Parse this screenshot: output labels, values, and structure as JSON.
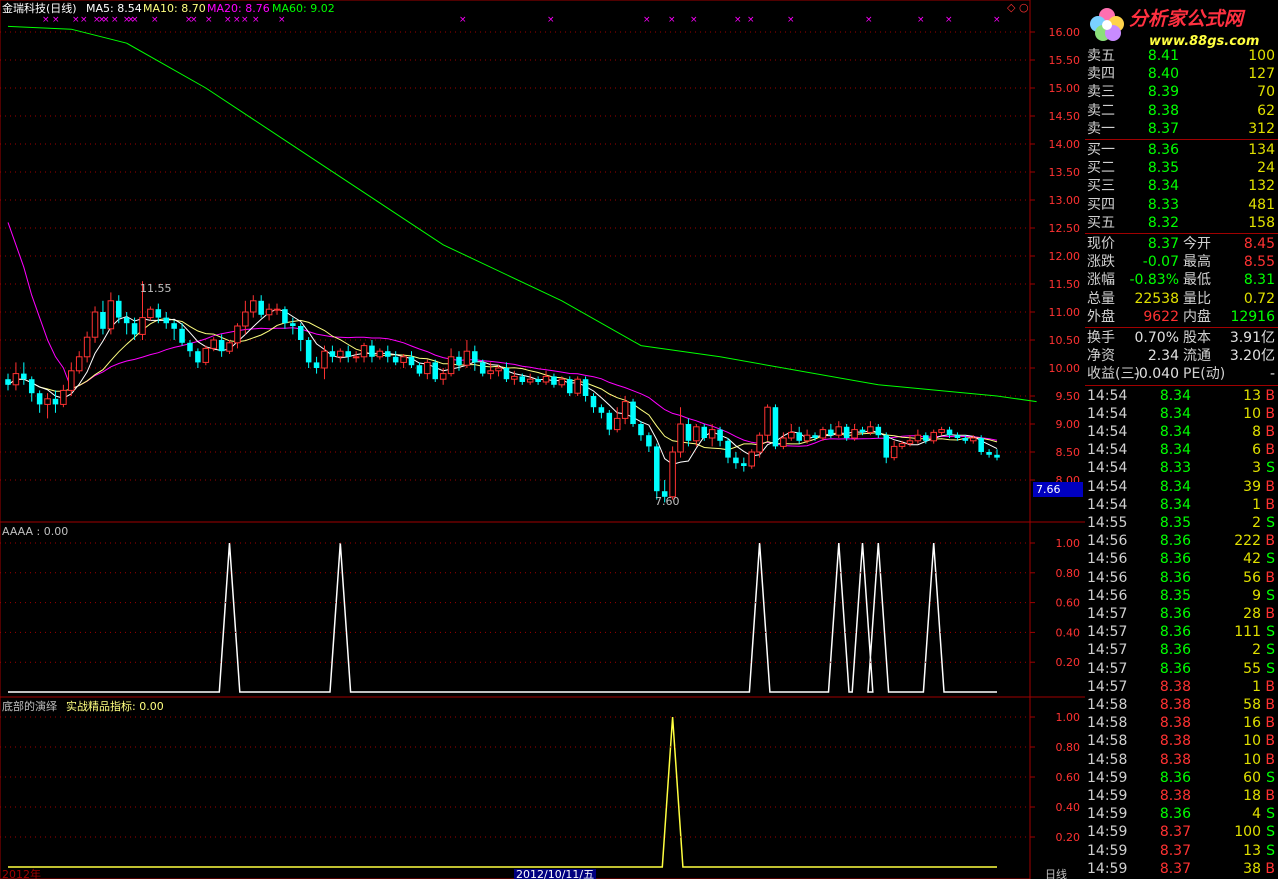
{
  "header": {
    "stock": "金瑞科技(日线)",
    "ma5": "MA5: 8.54",
    "ma10": "MA10: 8.70",
    "ma20": "MA20: 8.76",
    "ma60": "MA60: 9.02"
  },
  "price_axis": [
    "16.00",
    "15.50",
    "15.00",
    "14.50",
    "14.00",
    "13.50",
    "13.00",
    "12.50",
    "12.00",
    "11.50",
    "11.00",
    "10.50",
    "10.00",
    "9.50",
    "9.00",
    "8.50",
    "8.00"
  ],
  "current_price_tag": "7.66",
  "annotations": {
    "high": "11.55",
    "low": "7.60"
  },
  "panel2": {
    "title": "AAAA : 0.00",
    "axis": [
      "1.00",
      "0.80",
      "0.60",
      "0.40",
      "0.20"
    ]
  },
  "panel3": {
    "title": "底部的演绎",
    "indicator": "实战精品指标: 0.00",
    "axis": [
      "1.00",
      "0.80",
      "0.60",
      "0.40",
      "0.20"
    ]
  },
  "bottom_labels": {
    "left": "2012年",
    "date": "2012/10/11/五",
    "right": "日线"
  },
  "colors": {
    "up": "#ff3232",
    "down": "#00ffff",
    "ma5": "#ffffff",
    "ma10": "#ffff80",
    "ma20": "#ff00ff",
    "ma60": "#00ff00",
    "grid": "#a00000"
  },
  "logo": {
    "name": "分析家公式网",
    "url": "www.88gs.com"
  },
  "order_book": {
    "sell": [
      {
        "label": "卖五",
        "price": "8.41",
        "vol": "100"
      },
      {
        "label": "卖四",
        "price": "8.40",
        "vol": "127"
      },
      {
        "label": "卖三",
        "price": "8.39",
        "vol": "70"
      },
      {
        "label": "卖二",
        "price": "8.38",
        "vol": "62"
      },
      {
        "label": "卖一",
        "price": "8.37",
        "vol": "312"
      }
    ],
    "buy": [
      {
        "label": "买一",
        "price": "8.36",
        "vol": "134"
      },
      {
        "label": "买二",
        "price": "8.35",
        "vol": "24"
      },
      {
        "label": "买三",
        "price": "8.34",
        "vol": "132"
      },
      {
        "label": "买四",
        "price": "8.33",
        "vol": "481"
      },
      {
        "label": "买五",
        "price": "8.32",
        "vol": "158"
      }
    ]
  },
  "quote": [
    {
      "l1": "现价",
      "v1": "8.37",
      "c1": "dn",
      "l2": "今开",
      "v2": "8.45",
      "c2": "up"
    },
    {
      "l1": "涨跌",
      "v1": "-0.07",
      "c1": "dn",
      "l2": "最高",
      "v2": "8.55",
      "c2": "up"
    },
    {
      "l1": "涨幅",
      "v1": "-0.83%",
      "c1": "dn",
      "l2": "最低",
      "v2": "8.31",
      "c2": "dn"
    },
    {
      "l1": "总量",
      "v1": "22538",
      "c1": "yl",
      "l2": "量比",
      "v2": "0.72",
      "c2": "yl"
    },
    {
      "l1": "外盘",
      "v1": "9622",
      "c1": "up",
      "l2": "内盘",
      "v2": "12916",
      "c2": "dn"
    },
    {
      "l1": "换手",
      "v1": "0.70%",
      "c1": "wh",
      "l2": "股本",
      "v2": "3.91亿",
      "c2": "wh"
    },
    {
      "l1": "净资",
      "v1": "2.34",
      "c1": "wh",
      "l2": "流通",
      "v2": "3.20亿",
      "c2": "wh"
    },
    {
      "l1": "收益(三)",
      "v1": "-0.040",
      "c1": "wh",
      "l2": "PE(动)",
      "v2": "-",
      "c2": "wh"
    }
  ],
  "ticks": [
    {
      "t": "14:54",
      "p": "8.34",
      "v": "13",
      "f": "B"
    },
    {
      "t": "14:54",
      "p": "8.34",
      "v": "10",
      "f": "B"
    },
    {
      "t": "14:54",
      "p": "8.34",
      "v": "8",
      "f": "B"
    },
    {
      "t": "14:54",
      "p": "8.34",
      "v": "6",
      "f": "B"
    },
    {
      "t": "14:54",
      "p": "8.33",
      "v": "3",
      "f": "S"
    },
    {
      "t": "14:54",
      "p": "8.34",
      "v": "39",
      "f": "B"
    },
    {
      "t": "14:54",
      "p": "8.34",
      "v": "1",
      "f": "B"
    },
    {
      "t": "14:55",
      "p": "8.35",
      "v": "2",
      "f": "S"
    },
    {
      "t": "14:56",
      "p": "8.36",
      "v": "222",
      "f": "B"
    },
    {
      "t": "14:56",
      "p": "8.36",
      "v": "42",
      "f": "S"
    },
    {
      "t": "14:56",
      "p": "8.36",
      "v": "56",
      "f": "B"
    },
    {
      "t": "14:56",
      "p": "8.35",
      "v": "9",
      "f": "S"
    },
    {
      "t": "14:57",
      "p": "8.36",
      "v": "28",
      "f": "B"
    },
    {
      "t": "14:57",
      "p": "8.36",
      "v": "111",
      "f": "S"
    },
    {
      "t": "14:57",
      "p": "8.36",
      "v": "2",
      "f": "S"
    },
    {
      "t": "14:57",
      "p": "8.36",
      "v": "55",
      "f": "S"
    },
    {
      "t": "14:57",
      "p": "8.38",
      "v": "1",
      "f": "B"
    },
    {
      "t": "14:58",
      "p": "8.38",
      "v": "58",
      "f": "B"
    },
    {
      "t": "14:58",
      "p": "8.38",
      "v": "16",
      "f": "B"
    },
    {
      "t": "14:58",
      "p": "8.38",
      "v": "10",
      "f": "B"
    },
    {
      "t": "14:58",
      "p": "8.38",
      "v": "10",
      "f": "B"
    },
    {
      "t": "14:59",
      "p": "8.36",
      "v": "60",
      "f": "S"
    },
    {
      "t": "14:59",
      "p": "8.38",
      "v": "18",
      "f": "B"
    },
    {
      "t": "14:59",
      "p": "8.36",
      "v": "4",
      "f": "S"
    },
    {
      "t": "14:59",
      "p": "8.37",
      "v": "100",
      "f": "S"
    },
    {
      "t": "14:59",
      "p": "8.37",
      "v": "13",
      "f": "S"
    },
    {
      "t": "14:59",
      "p": "8.37",
      "v": "38",
      "f": "B"
    }
  ],
  "chart_data": {
    "type": "candlestick",
    "ylim": [
      8.0,
      16.0
    ],
    "candles": [
      [
        9.8,
        9.7,
        9.9,
        9.6
      ],
      [
        9.7,
        9.9,
        10.1,
        9.6
      ],
      [
        9.9,
        9.8,
        10.1,
        9.7
      ],
      [
        9.8,
        9.55,
        9.85,
        9.4
      ],
      [
        9.55,
        9.35,
        9.6,
        9.2
      ],
      [
        9.35,
        9.45,
        9.55,
        9.1
      ],
      [
        9.45,
        9.35,
        9.6,
        9.2
      ],
      [
        9.35,
        9.6,
        9.7,
        9.3
      ],
      [
        9.6,
        9.95,
        10.1,
        9.5
      ],
      [
        9.95,
        10.2,
        10.3,
        9.9
      ],
      [
        10.2,
        10.55,
        10.65,
        10.1
      ],
      [
        10.55,
        11.0,
        11.1,
        10.45
      ],
      [
        11.0,
        10.7,
        11.2,
        10.6
      ],
      [
        10.7,
        11.2,
        11.35,
        10.6
      ],
      [
        11.2,
        10.9,
        11.3,
        10.8
      ],
      [
        10.9,
        10.8,
        11.0,
        10.6
      ],
      [
        10.8,
        10.6,
        10.9,
        10.5
      ],
      [
        10.6,
        10.9,
        11.55,
        10.5
      ],
      [
        10.9,
        11.05,
        11.1,
        10.85
      ],
      [
        11.05,
        10.9,
        11.15,
        10.8
      ],
      [
        10.9,
        10.8,
        11.0,
        10.7
      ],
      [
        10.8,
        10.7,
        10.85,
        10.5
      ],
      [
        10.7,
        10.45,
        10.8,
        10.4
      ],
      [
        10.45,
        10.3,
        10.5,
        10.2
      ],
      [
        10.3,
        10.1,
        10.35,
        10.0
      ],
      [
        10.1,
        10.35,
        10.4,
        10.05
      ],
      [
        10.35,
        10.5,
        10.55,
        10.3
      ],
      [
        10.5,
        10.3,
        10.6,
        10.2
      ],
      [
        10.3,
        10.45,
        10.5,
        10.25
      ],
      [
        10.45,
        10.75,
        10.8,
        10.35
      ],
      [
        10.75,
        11.0,
        11.2,
        10.6
      ],
      [
        11.0,
        11.2,
        11.3,
        10.9
      ],
      [
        11.2,
        10.95,
        11.3,
        10.9
      ],
      [
        10.95,
        11.05,
        11.15,
        10.85
      ],
      [
        11.05,
        11.05,
        11.15,
        10.95
      ],
      [
        11.05,
        10.8,
        11.1,
        10.7
      ],
      [
        10.8,
        10.75,
        10.9,
        10.6
      ],
      [
        10.75,
        10.5,
        10.8,
        10.3
      ],
      [
        10.5,
        10.1,
        10.55,
        10.0
      ],
      [
        10.1,
        10.0,
        10.2,
        9.9
      ],
      [
        10.0,
        10.3,
        10.4,
        9.8
      ],
      [
        10.3,
        10.2,
        10.4,
        10.1
      ],
      [
        10.2,
        10.3,
        10.35,
        10.1
      ],
      [
        10.3,
        10.2,
        10.4,
        10.1
      ],
      [
        10.2,
        10.2,
        10.3,
        10.1
      ],
      [
        10.2,
        10.4,
        10.45,
        10.1
      ],
      [
        10.4,
        10.2,
        10.5,
        10.1
      ],
      [
        10.2,
        10.3,
        10.35,
        10.15
      ],
      [
        10.3,
        10.2,
        10.4,
        10.1
      ],
      [
        10.2,
        10.1,
        10.3,
        10.05
      ],
      [
        10.1,
        10.2,
        10.25,
        10.0
      ],
      [
        10.2,
        10.05,
        10.3,
        10.0
      ],
      [
        10.05,
        9.9,
        10.1,
        9.85
      ],
      [
        9.9,
        10.1,
        10.15,
        9.8
      ],
      [
        10.1,
        9.8,
        10.15,
        9.75
      ],
      [
        9.8,
        9.9,
        10.0,
        9.7
      ],
      [
        9.9,
        10.2,
        10.35,
        9.85
      ],
      [
        10.2,
        10.05,
        10.3,
        9.95
      ],
      [
        10.05,
        10.3,
        10.5,
        10.0
      ],
      [
        10.3,
        10.1,
        10.4,
        9.95
      ],
      [
        10.1,
        9.9,
        10.15,
        9.85
      ],
      [
        9.9,
        9.95,
        10.1,
        9.8
      ],
      [
        9.95,
        10.0,
        10.05,
        9.85
      ],
      [
        10.0,
        9.8,
        10.1,
        9.75
      ],
      [
        9.8,
        9.85,
        9.95,
        9.7
      ],
      [
        9.85,
        9.75,
        9.9,
        9.7
      ],
      [
        9.75,
        9.8,
        9.9,
        9.7
      ],
      [
        9.8,
        9.75,
        9.85,
        9.7
      ],
      [
        9.75,
        9.85,
        9.95,
        9.7
      ],
      [
        9.85,
        9.7,
        9.9,
        9.65
      ],
      [
        9.7,
        9.8,
        9.85,
        9.65
      ],
      [
        9.8,
        9.55,
        9.85,
        9.5
      ],
      [
        9.55,
        9.8,
        9.85,
        9.5
      ],
      [
        9.8,
        9.5,
        9.85,
        9.4
      ],
      [
        9.5,
        9.3,
        9.55,
        9.2
      ],
      [
        9.3,
        9.2,
        9.35,
        9.1
      ],
      [
        9.2,
        8.9,
        9.25,
        8.8
      ],
      [
        8.9,
        9.1,
        9.3,
        8.85
      ],
      [
        9.1,
        9.4,
        9.5,
        9.0
      ],
      [
        9.4,
        9.0,
        9.45,
        8.95
      ],
      [
        9.0,
        8.8,
        9.05,
        8.7
      ],
      [
        8.8,
        8.6,
        8.85,
        8.5
      ],
      [
        8.6,
        7.8,
        8.65,
        7.65
      ],
      [
        7.8,
        7.7,
        8.0,
        7.6
      ],
      [
        7.7,
        8.5,
        8.6,
        7.65
      ],
      [
        8.5,
        9.0,
        9.3,
        8.4
      ],
      [
        9.0,
        8.7,
        9.1,
        8.6
      ],
      [
        8.7,
        8.95,
        9.0,
        8.6
      ],
      [
        8.95,
        8.75,
        9.0,
        8.7
      ],
      [
        8.75,
        8.9,
        9.0,
        8.6
      ],
      [
        8.9,
        8.7,
        8.95,
        8.6
      ],
      [
        8.7,
        8.4,
        8.75,
        8.3
      ],
      [
        8.4,
        8.3,
        8.5,
        8.2
      ],
      [
        8.3,
        8.25,
        8.4,
        8.15
      ],
      [
        8.25,
        8.5,
        8.55,
        8.2
      ],
      [
        8.5,
        8.8,
        8.85,
        8.4
      ],
      [
        8.8,
        9.3,
        9.35,
        8.7
      ],
      [
        9.3,
        8.6,
        9.35,
        8.55
      ],
      [
        8.6,
        8.75,
        8.85,
        8.55
      ],
      [
        8.75,
        8.85,
        9.0,
        8.7
      ],
      [
        8.85,
        8.7,
        8.95,
        8.65
      ],
      [
        8.7,
        8.8,
        8.9,
        8.65
      ],
      [
        8.8,
        8.75,
        8.85,
        8.7
      ],
      [
        8.75,
        8.9,
        8.95,
        8.7
      ],
      [
        8.9,
        8.8,
        9.0,
        8.75
      ],
      [
        8.8,
        8.95,
        9.05,
        8.75
      ],
      [
        8.95,
        8.75,
        9.0,
        8.7
      ],
      [
        8.75,
        8.9,
        9.0,
        8.7
      ],
      [
        8.9,
        8.85,
        8.95,
        8.8
      ],
      [
        8.85,
        8.95,
        9.05,
        8.8
      ],
      [
        8.95,
        8.8,
        9.0,
        8.75
      ],
      [
        8.8,
        8.4,
        8.85,
        8.3
      ],
      [
        8.4,
        8.6,
        8.7,
        8.35
      ],
      [
        8.6,
        8.65,
        8.7,
        8.55
      ],
      [
        8.65,
        8.7,
        8.8,
        8.6
      ],
      [
        8.7,
        8.8,
        8.9,
        8.65
      ],
      [
        8.8,
        8.7,
        8.85,
        8.65
      ],
      [
        8.7,
        8.85,
        8.9,
        8.65
      ],
      [
        8.85,
        8.9,
        8.95,
        8.8
      ],
      [
        8.9,
        8.8,
        8.95,
        8.75
      ],
      [
        8.8,
        8.75,
        8.85,
        8.7
      ],
      [
        8.75,
        8.7,
        8.8,
        8.65
      ],
      [
        8.7,
        8.75,
        8.8,
        8.65
      ],
      [
        8.75,
        8.5,
        8.8,
        8.45
      ],
      [
        8.5,
        8.45,
        8.55,
        8.4
      ],
      [
        8.45,
        8.4,
        8.55,
        8.35
      ]
    ],
    "ma60": [
      [
        0,
        16.1
      ],
      [
        8,
        16.05
      ],
      [
        15,
        15.8
      ],
      [
        25,
        15.0
      ],
      [
        40,
        13.6
      ],
      [
        55,
        12.2
      ],
      [
        70,
        11.2
      ],
      [
        80,
        10.4
      ],
      [
        90,
        10.2
      ],
      [
        110,
        9.7
      ],
      [
        125,
        9.5
      ],
      [
        130,
        9.4
      ]
    ],
    "signals_panel2": [
      28,
      42,
      95,
      105,
      108,
      110,
      117
    ],
    "signals_panel3": [
      84
    ]
  }
}
